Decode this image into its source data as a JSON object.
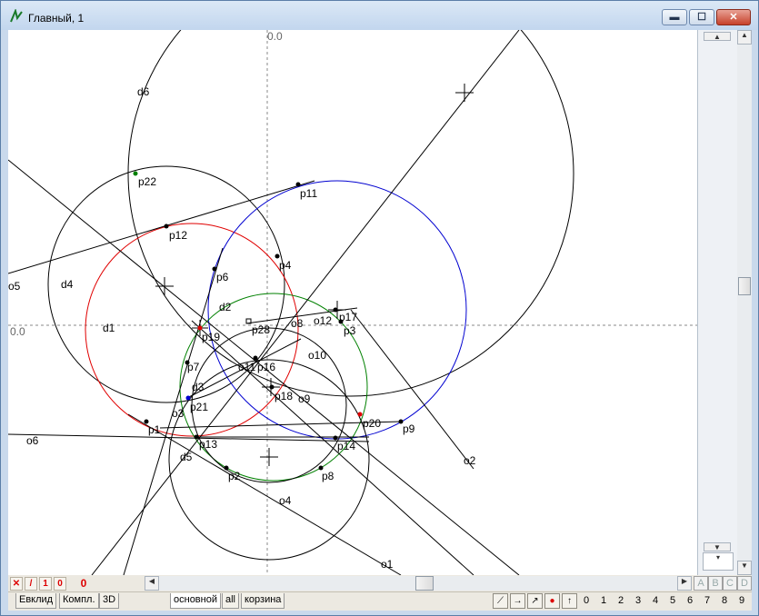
{
  "window": {
    "title": "Главный, 1"
  },
  "controls": {
    "minimize": "▬",
    "maximize": "☐",
    "close": "✕"
  },
  "axis": {
    "top_label": "0.0",
    "left_label": "0.0"
  },
  "labels": {
    "d6": "d6",
    "p22": "p22",
    "p11": "p11",
    "p12": "p12",
    "o5": "o5",
    "d4": "d4",
    "p4": "p4",
    "p6": "p6",
    "d2": "d2",
    "p28": "p28",
    "o8": "o8",
    "o12": "o12",
    "p17": "p17",
    "p3": "p3",
    "d1": "d1",
    "p19": "p19",
    "o10": "o10",
    "p7": "p7",
    "o11": "o11",
    "p16": "p16",
    "d3": "d3",
    "p18": "p18",
    "o9": "o9",
    "p21": "p21",
    "o3": "o3",
    "p20": "p20",
    "p9": "p9",
    "p1": "p1",
    "o6": "o6",
    "p13": "p13",
    "p14": "p14",
    "d5": "d5",
    "o2": "o2",
    "p2": "p2",
    "p8": "p8",
    "o4": "o4",
    "o1": "o1"
  },
  "bottom": {
    "x_btn": "✕",
    "slash_btn": "/",
    "one_btn": "1",
    "zero_btn": "0",
    "counter": "0"
  },
  "tabs": [
    "Евклид",
    "Компл.",
    "3D",
    "основной",
    "all",
    "корзина"
  ],
  "numbers": [
    "0",
    "1",
    "2",
    "3",
    "4",
    "5",
    "6",
    "7",
    "8",
    "9"
  ],
  "letters": [
    "A",
    "B",
    "C",
    "D"
  ],
  "colors": {
    "red": "#e00000",
    "blue": "#0000d0",
    "green": "#008000",
    "black": "#000000"
  }
}
